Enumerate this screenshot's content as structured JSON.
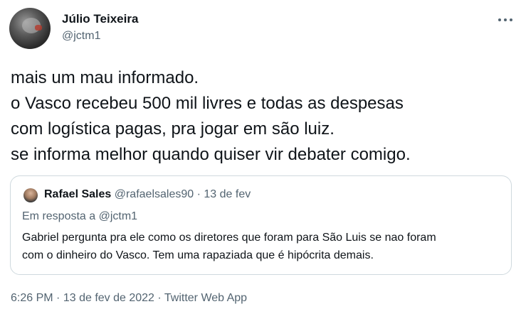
{
  "author": {
    "name": "Júlio Teixeira",
    "handle": "@jctm1",
    "avatar_icon": "profile-photo"
  },
  "more_icon": "more-horizontal-icon",
  "tweet": {
    "lines": [
      "mais um mau informado.",
      "o Vasco recebeu 500 mil livres e todas as despesas",
      "com logística pagas, pra jogar em são luiz.",
      "se informa melhor quando quiser vir debater comigo."
    ]
  },
  "quote": {
    "name": "Rafael Sales",
    "handle": "@rafaelsales90",
    "separator": "·",
    "date": "13 de fev",
    "reply_to": "Em resposta a @jctm1",
    "lines": [
      "Gabriel pergunta pra ele como os diretores que foram para São Luis se nao foram",
      "com o dinheiro do Vasco. Tem uma rapaziada que é hipócrita demais."
    ]
  },
  "footer": {
    "time": "6:26 PM",
    "separator": "·",
    "date": "13 de fev de 2022",
    "source": "Twitter Web App"
  },
  "colors": {
    "text": "#0f1419",
    "secondary": "#536471",
    "border": "#cfd9de"
  }
}
